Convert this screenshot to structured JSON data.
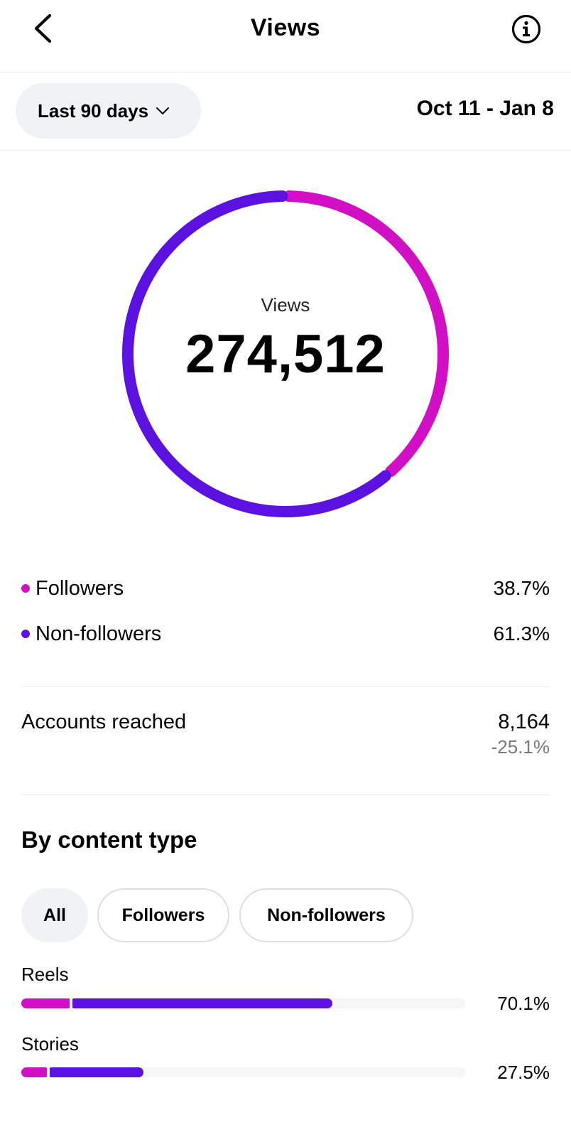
{
  "colors": {
    "followers": "#d10fc4",
    "non_followers": "#5b11e0",
    "text_secondary": "#7b7b7b"
  },
  "header": {
    "title": "Views",
    "back_icon": "chevron-left-icon",
    "info_icon": "info-circle-icon"
  },
  "filter": {
    "range_label": "Last 90 days",
    "date_range": "Oct 11 - Jan 8"
  },
  "donut": {
    "caption": "Views",
    "total": "274,512",
    "followers_fraction": 0.387,
    "non_followers_fraction": 0.613
  },
  "audience": [
    {
      "label": "Followers",
      "value": "38.7%"
    },
    {
      "label": "Non-followers",
      "value": "61.3%"
    }
  ],
  "accounts_reached": {
    "label": "Accounts reached",
    "value": "8,164",
    "change": "-25.1%"
  },
  "content_type": {
    "title": "By content type",
    "chips": [
      {
        "label": "All",
        "active": true
      },
      {
        "label": "Followers",
        "active": false
      },
      {
        "label": "Non-followers",
        "active": false
      }
    ],
    "rows": [
      {
        "label": "Reels",
        "value": "70.1%",
        "total_fraction": 0.701,
        "followers_fraction": 0.16
      },
      {
        "label": "Stories",
        "value": "27.5%",
        "total_fraction": 0.275,
        "followers_fraction": 0.22
      }
    ]
  }
}
